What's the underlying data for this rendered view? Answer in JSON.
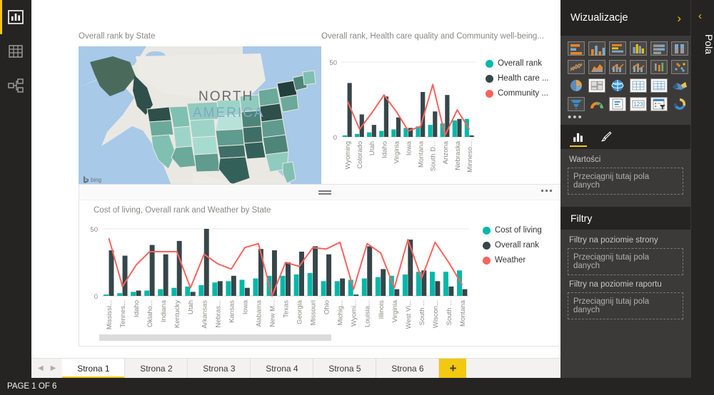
{
  "app": {
    "left_rail": [
      {
        "name": "report-view",
        "icon": "bar-chart-icon",
        "active": true
      },
      {
        "name": "data-view",
        "icon": "table-grid-icon",
        "active": false
      },
      {
        "name": "model-view",
        "icon": "relationships-icon",
        "active": false
      }
    ]
  },
  "visuals": {
    "map": {
      "title": "Overall rank by State",
      "label_north": "NORTH",
      "label_america": "AMERICA",
      "attribution": "bing"
    },
    "combo_top": {
      "title": "Overall rank, Health care quality and Community well-being..."
    },
    "combo_bottom": {
      "title": "Cost of living, Overall rank and Weather by State"
    }
  },
  "colors": {
    "teal": "#01B8AA",
    "dark": "#374649",
    "coral": "#FD625E",
    "accent_yellow": "#F2C811",
    "panel_dark": "#252423",
    "panel_gray": "#3b3a39"
  },
  "right_panel": {
    "title": "Wizualizacje",
    "expand_icon": "chevron-right-icon",
    "viz_icons": [
      "stacked-bar-chart-icon",
      "stacked-column-chart-icon",
      "clustered-bar-chart-icon",
      "clustered-column-chart-icon",
      "100-stacked-bar-chart-icon",
      "100-stacked-column-chart-icon",
      "line-chart-icon",
      "area-chart-icon",
      "stacked-area-chart-icon",
      "line-stacked-column-chart-icon",
      "ribbon-chart-icon",
      "scatter-chart-icon",
      "pie-chart-icon",
      "treemap-icon",
      "map-icon",
      "table-icon",
      "matrix-icon",
      "filled-map-icon",
      "funnel-chart-icon",
      "gauge-icon",
      "card-icon",
      "multi-row-card-icon",
      "slicer-icon",
      "donut-chart-icon"
    ],
    "more_icon": "ellipsis-icon",
    "tabs": [
      {
        "name": "fields-tab",
        "icon": "bar-chart-icon",
        "active": true
      },
      {
        "name": "format-tab",
        "icon": "paintbrush-icon",
        "active": false
      }
    ],
    "values_label": "Wartości",
    "values_dropzone": "Przeciągnij tutaj pola danych",
    "filters_title": "Filtry",
    "page_filters_label": "Filtry na poziomie strony",
    "page_filters_dropzone": "Przeciągnij tutaj pola danych",
    "report_filters_label": "Filtry na poziomie raportu",
    "report_filters_dropzone": "Przeciągnij tutaj pola danych"
  },
  "fields_rail": {
    "title": "Pola",
    "collapse_icon": "chevron-left-icon"
  },
  "tabbar": {
    "prev_icon": "chevron-left-icon",
    "next_icon": "chevron-right-icon",
    "tabs": [
      {
        "label": "Strona 1",
        "active": true
      },
      {
        "label": "Strona 2",
        "active": false
      },
      {
        "label": "Strona 3",
        "active": false
      },
      {
        "label": "Strona 4",
        "active": false
      },
      {
        "label": "Strona 5",
        "active": false
      },
      {
        "label": "Strona 6",
        "active": false
      }
    ],
    "add_label": "+"
  },
  "statusbar": {
    "text": "PAGE 1 OF 6"
  },
  "chart_data": [
    {
      "id": "combo_top",
      "type": "bar",
      "title": "Overall rank, Health care quality and Community well-being...",
      "xlabel": "",
      "ylabel": "",
      "ylim": [
        0,
        50
      ],
      "yticks": [
        0,
        50
      ],
      "grid": true,
      "legend_position": "right",
      "categories": [
        "Wyoming",
        "Colorado",
        "Utah",
        "Idaho",
        "Virginia",
        "Iowa",
        "Montana",
        "South D...",
        "Arizona",
        "Nebraska",
        "Minneso..."
      ],
      "series": [
        {
          "name": "Overall rank",
          "type": "column",
          "color": "#01B8AA",
          "values": [
            1,
            2,
            3,
            4,
            5,
            6,
            7,
            8,
            9,
            11,
            12
          ]
        },
        {
          "name": "Health care ...",
          "type": "column",
          "color": "#374649",
          "values": [
            36,
            15,
            8,
            27,
            13,
            6,
            30,
            17,
            28,
            12,
            1
          ]
        },
        {
          "name": "Community ...",
          "type": "line",
          "color": "#FD625E",
          "values": [
            24,
            5,
            16,
            28,
            17,
            4,
            7,
            35,
            1,
            18,
            5
          ]
        }
      ]
    },
    {
      "id": "combo_bottom",
      "type": "bar",
      "title": "Cost of living, Overall rank and Weather by State",
      "xlabel": "",
      "ylabel": "",
      "ylim": [
        0,
        50
      ],
      "yticks": [
        0,
        50
      ],
      "grid": true,
      "legend_position": "right",
      "categories": [
        "Mississi...",
        "Tennes...",
        "Idaho",
        "Oklaho...",
        "Indiana",
        "Kentucky",
        "Utah",
        "Arkansas",
        "Nebras...",
        "Kansas",
        "Iowa",
        "Alabama",
        "New M...",
        "Texas",
        "Georgia",
        "Missouri",
        "Ohio",
        "Michig...",
        "Wyomi...",
        "Louisia...",
        "Illinois",
        "Virginia",
        "West Vi...",
        "South ...",
        "Wiscon...",
        "South ...",
        "Montana"
      ],
      "series": [
        {
          "name": "Cost of living",
          "type": "column",
          "color": "#01B8AA",
          "values": [
            1,
            2,
            3,
            4,
            5,
            6,
            7,
            8,
            10,
            11,
            12,
            13,
            15,
            15,
            16,
            17,
            11,
            11,
            12,
            13,
            14,
            15,
            16,
            18,
            18,
            18,
            19
          ]
        },
        {
          "name": "Overall rank",
          "type": "column",
          "color": "#374649",
          "values": [
            34,
            30,
            4,
            38,
            31,
            41,
            3,
            50,
            11,
            15,
            6,
            35,
            34,
            25,
            33,
            37,
            31,
            13,
            1,
            37,
            20,
            5,
            42,
            19,
            11,
            7,
            5
          ]
        },
        {
          "name": "Weather",
          "type": "line",
          "color": "#FD625E",
          "values": [
            43,
            7,
            23,
            33,
            33,
            33,
            6,
            31,
            24,
            20,
            36,
            39,
            0,
            25,
            22,
            36,
            35,
            40,
            5,
            39,
            32,
            6,
            42,
            13,
            40,
            25,
            8
          ]
        }
      ]
    }
  ]
}
